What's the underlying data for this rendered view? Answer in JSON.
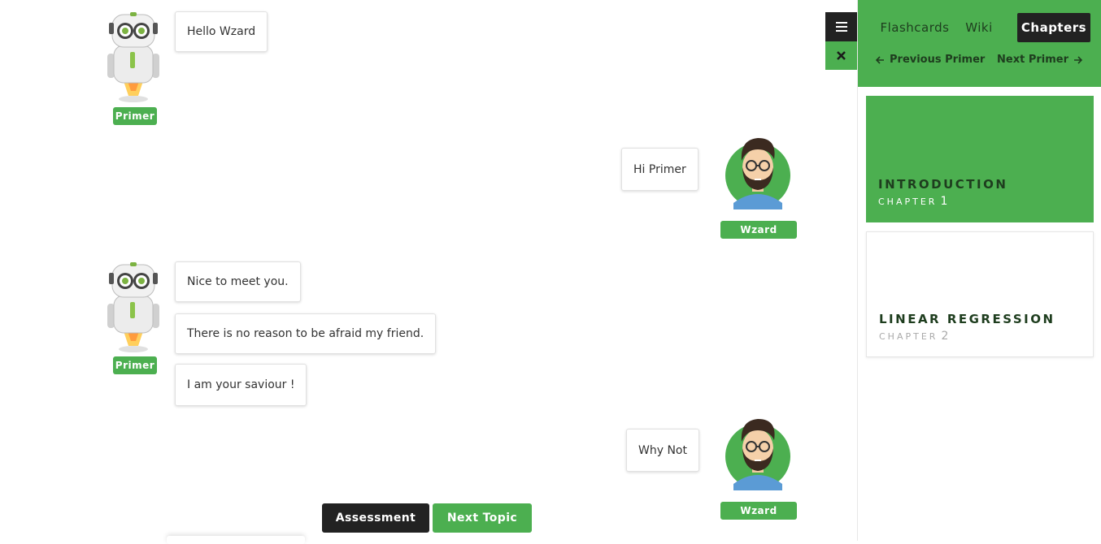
{
  "chat": {
    "bot_name": "Primer",
    "user_name": "Wzard",
    "messages": [
      {
        "from": "bot",
        "texts": [
          "Hello Wzard"
        ]
      },
      {
        "from": "user",
        "texts": [
          "Hi Primer"
        ]
      },
      {
        "from": "bot",
        "texts": [
          "Nice to meet you.",
          "There is no reason to be afraid my friend.",
          "I am your saviour !"
        ]
      },
      {
        "from": "user",
        "texts": [
          "Why Not"
        ]
      }
    ]
  },
  "actions": {
    "assessment_label": "Assessment",
    "next_topic_label": "Next Topic"
  },
  "sidebar": {
    "tabs": [
      {
        "label": "Flashcards",
        "active": false
      },
      {
        "label": "Wiki",
        "active": false
      },
      {
        "label": "Chapters",
        "active": true
      }
    ],
    "previous_label": "Previous Primer",
    "next_label": "Next Primer",
    "chapters": [
      {
        "title": "INTRODUCTION",
        "sub": "CHAPTER",
        "num": "1",
        "active": true
      },
      {
        "title": "LINEAR REGRESSION",
        "sub": "CHAPTER",
        "num": "2",
        "active": false
      }
    ]
  },
  "icons": {
    "menu": "hamburger-icon",
    "close": "close-icon",
    "prev": "arrow-left-icon",
    "next": "arrow-right-icon"
  },
  "colors": {
    "accent": "#4caf50",
    "dark": "#222222",
    "chapter_title": "#1e3d1e"
  }
}
